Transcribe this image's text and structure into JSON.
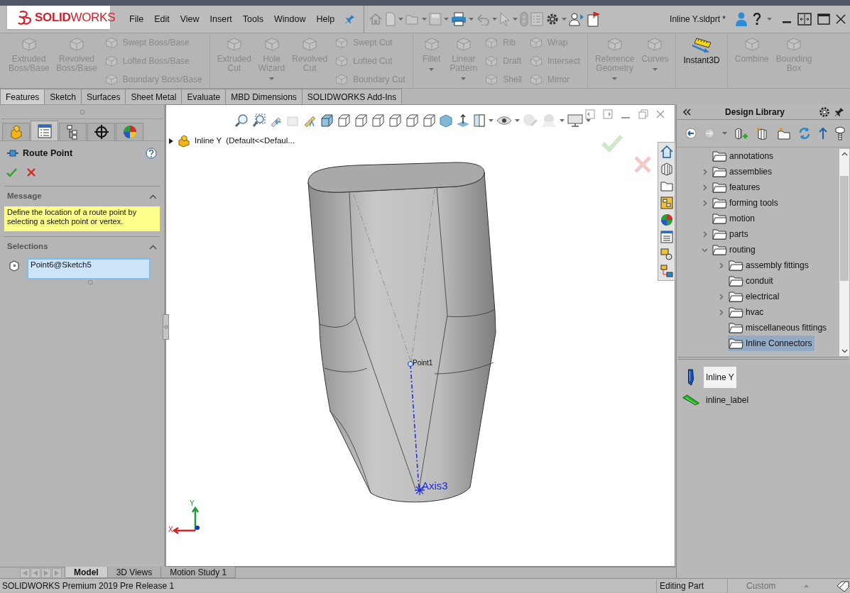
{
  "title_bar": {
    "logo": "**SOLID**WORKS",
    "menus": [
      "File",
      "Edit",
      "View",
      "Insert",
      "Tools",
      "Window",
      "Help"
    ],
    "document": "Inline Y.sldprt *"
  },
  "command_groups": [
    {
      "items": [
        {
          "kind": "large",
          "label": "Extruded Boss/Base",
          "disabled": true,
          "dropdown": false
        },
        {
          "kind": "large",
          "label": "Revolved Boss/Base",
          "disabled": true,
          "dropdown": false
        },
        {
          "kind": "stack",
          "items": [
            {
              "label": "Swept Boss/Base",
              "disabled": true
            },
            {
              "label": "Lofted Boss/Base",
              "disabled": true
            },
            {
              "label": "Boundary Boss/Base",
              "disabled": true
            }
          ]
        }
      ]
    },
    {
      "items": [
        {
          "kind": "large",
          "label": "Extruded Cut",
          "disabled": true,
          "dropdown": false
        },
        {
          "kind": "large",
          "label": "Hole Wizard",
          "disabled": true,
          "dropdown": true
        },
        {
          "kind": "large",
          "label": "Revolved Cut",
          "disabled": true,
          "dropdown": false
        },
        {
          "kind": "stack",
          "items": [
            {
              "label": "Swept Cut",
              "disabled": true
            },
            {
              "label": "Lofted Cut",
              "disabled": true
            },
            {
              "label": "Boundary Cut",
              "disabled": true
            }
          ]
        }
      ]
    },
    {
      "items": [
        {
          "kind": "large",
          "label": "Fillet",
          "disabled": true,
          "dropdown": true
        },
        {
          "kind": "large",
          "label": "Linear Pattern",
          "disabled": true,
          "dropdown": true
        },
        {
          "kind": "stack",
          "items": [
            {
              "label": "Rib",
              "disabled": true
            },
            {
              "label": "Draft",
              "disabled": true
            },
            {
              "label": "Shell",
              "disabled": true
            }
          ]
        },
        {
          "kind": "stack",
          "items": [
            {
              "label": "Wrap",
              "disabled": true
            },
            {
              "label": "Intersect",
              "disabled": true
            },
            {
              "label": "Mirror",
              "disabled": true
            }
          ]
        }
      ]
    },
    {
      "items": [
        {
          "kind": "large",
          "label": "Reference Geometry",
          "disabled": true,
          "dropdown": true
        },
        {
          "kind": "large",
          "label": "Curves",
          "disabled": true,
          "dropdown": true
        }
      ]
    },
    {
      "items": [
        {
          "kind": "large",
          "label": "Instant3D",
          "disabled": false,
          "dropdown": false
        }
      ]
    },
    {
      "items": [
        {
          "kind": "large",
          "label": "Combine",
          "disabled": true,
          "dropdown": false
        },
        {
          "kind": "large",
          "label": "Bounding Box",
          "disabled": true,
          "dropdown": false
        }
      ]
    }
  ],
  "tabs": [
    {
      "label": "Features",
      "selected": true
    },
    {
      "label": "Sketch",
      "selected": false
    },
    {
      "label": "Surfaces",
      "selected": false
    },
    {
      "label": "Sheet Metal",
      "selected": false
    },
    {
      "label": "Evaluate",
      "selected": false
    },
    {
      "label": "MBD Dimensions",
      "selected": false
    },
    {
      "label": "SOLIDWORKS Add-Ins",
      "selected": false
    }
  ],
  "property_manager": {
    "tabs": [
      {
        "selected": false
      },
      {
        "selected": true
      },
      {
        "selected": false
      },
      {
        "selected": false
      },
      {
        "selected": false
      }
    ],
    "title": "Route Point",
    "sections": [
      {
        "kind": "message",
        "title": "Message",
        "expanded": true,
        "text": "Define the location of a route point by selecting a sketch point or vertex."
      },
      {
        "kind": "selection",
        "title": "Selections",
        "expanded": true,
        "value": "Point6@Sketch5"
      }
    ]
  },
  "viewport": {
    "tree_root": "Inline Y  (Default<<Defaul...",
    "point_label": "Point1",
    "axis_label": "Axis3",
    "triad": {
      "y": "Y",
      "x": "X"
    }
  },
  "design_library": {
    "title": "Design Library",
    "tree": [
      {
        "label": "annotations",
        "selected": false
      },
      {
        "label": "assemblies",
        "expanded": false,
        "selected": false
      },
      {
        "label": "features",
        "expanded": false,
        "selected": false
      },
      {
        "label": "forming tools",
        "expanded": false,
        "selected": false
      },
      {
        "label": "motion",
        "selected": false
      },
      {
        "label": "parts",
        "expanded": false,
        "selected": false
      },
      {
        "label": "routing",
        "expanded": true,
        "selected": false,
        "children": [
          {
            "label": "assembly fittings",
            "expanded": false,
            "selected": false
          },
          {
            "label": "conduit",
            "selected": false
          },
          {
            "label": "electrical",
            "expanded": false,
            "selected": false
          },
          {
            "label": "hvac",
            "expanded": false,
            "selected": false
          },
          {
            "label": "miscellaneous fittings",
            "selected": false
          },
          {
            "label": "Inline Connectors",
            "selected": true
          }
        ]
      }
    ],
    "files": [
      {
        "kind": "part",
        "label": "Inline Y",
        "selected": true
      },
      {
        "kind": "label",
        "label": "inline_label",
        "selected": false
      }
    ]
  },
  "bottom_tabs": [
    {
      "label": "Model",
      "selected": true
    },
    {
      "label": "3D Views",
      "selected": false
    },
    {
      "label": "Motion Study 1",
      "selected": false
    }
  ],
  "status_bar": {
    "product": "SOLIDWORKS Premium 2019 Pre Release 1",
    "mode": "Editing Part",
    "units": {
      "label": "Custom",
      "disabled": true
    }
  }
}
